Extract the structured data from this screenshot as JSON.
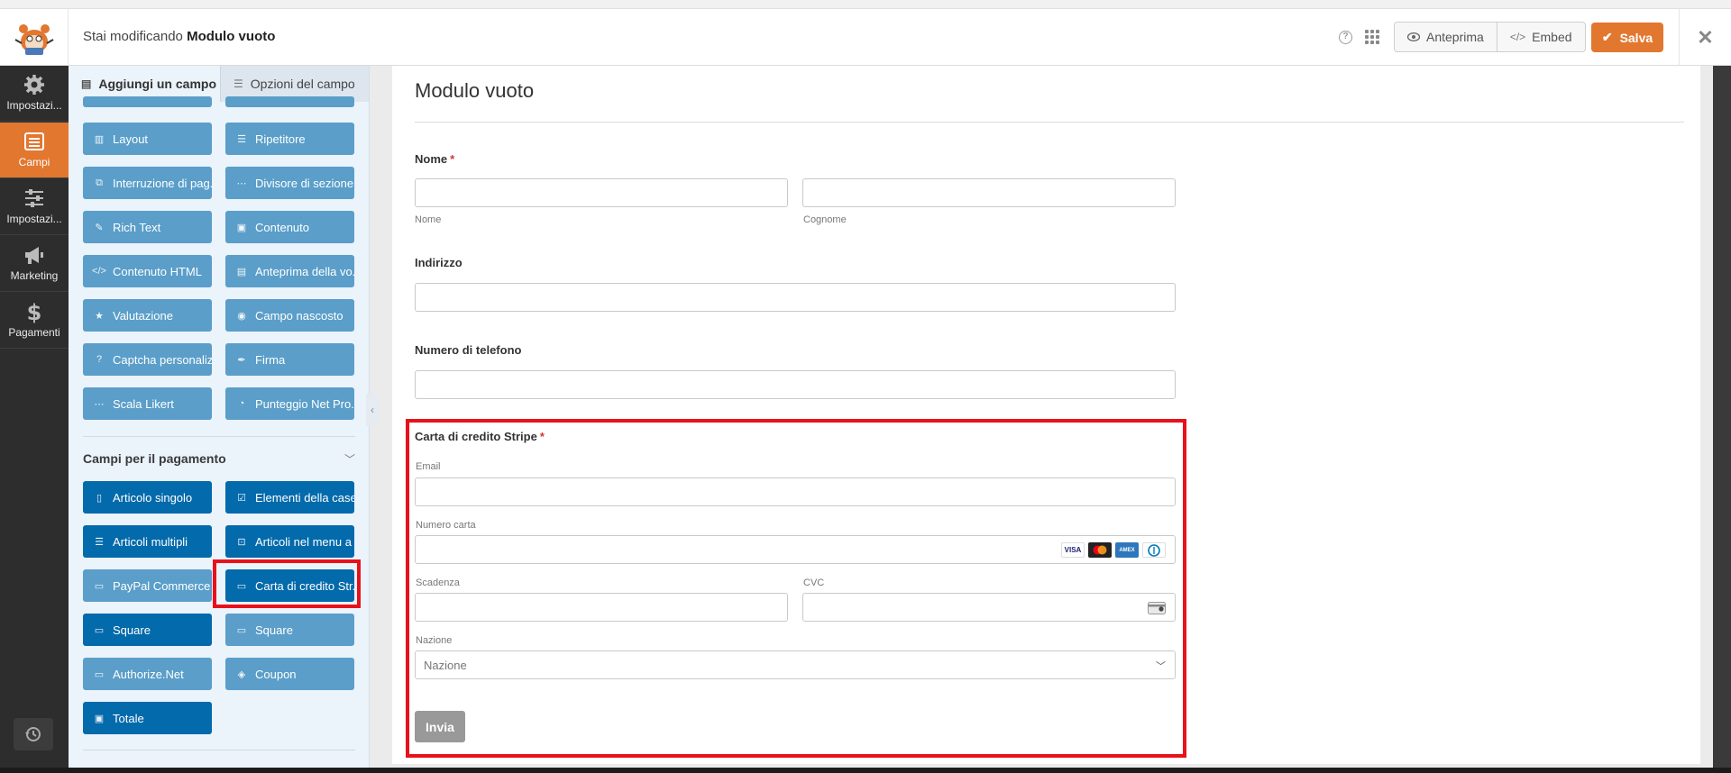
{
  "header": {
    "editing_prefix": "Stai modificando",
    "form_name": "Modulo vuoto",
    "preview_label": "Anteprima",
    "embed_label": "Embed",
    "save_label": "Salva"
  },
  "leftnav": {
    "items": [
      {
        "label": "Impostazi...",
        "icon": "gear-icon"
      },
      {
        "label": "Campi",
        "icon": "fields-icon",
        "active": true
      },
      {
        "label": "Impostazi...",
        "icon": "sliders-icon"
      },
      {
        "label": "Marketing",
        "icon": "megaphone-icon"
      },
      {
        "label": "Pagamenti",
        "icon": "dollar-icon"
      }
    ]
  },
  "panel": {
    "tab_add": "Aggiungi un campo",
    "tab_options": "Opzioni del campo",
    "fancy_fields": [
      "Layout",
      "Ripetitore",
      "Interruzione di pag...",
      "Divisore di sezione",
      "Rich Text",
      "Contenuto",
      "Contenuto HTML",
      "Anteprima della vo...",
      "Valutazione",
      "Campo nascosto",
      "Captcha personaliz...",
      "Firma",
      "Scala Likert",
      "Punteggio Net Pro..."
    ],
    "payment_section_title": "Campi per il pagamento",
    "payment_fields": [
      "Articolo singolo",
      "Elementi della case...",
      "Articoli multipli",
      "Articoli nel menu a ...",
      "PayPal Commerce",
      "Carta di credito Str...",
      "Square",
      "Square",
      "Authorize.Net",
      "Coupon",
      "Totale"
    ]
  },
  "form": {
    "title": "Modulo vuoto",
    "name_label": "Nome",
    "first_sub": "Nome",
    "last_sub": "Cognome",
    "address_label": "Indirizzo",
    "phone_label": "Numero di telefono",
    "stripe_label": "Carta di credito Stripe",
    "email_sub": "Email",
    "card_number_sub": "Numero carta",
    "expiry_sub": "Scadenza",
    "cvc_sub": "CVC",
    "country_sub": "Nazione",
    "country_placeholder": "Nazione",
    "card_brands": [
      "VISA",
      "MC",
      "AMEX",
      "DC"
    ],
    "submit_label": "Invia"
  },
  "colors": {
    "accent": "#e27730",
    "field_light": "#5a9ec9",
    "field_dark": "#036aab",
    "highlight": "#e8111b"
  }
}
